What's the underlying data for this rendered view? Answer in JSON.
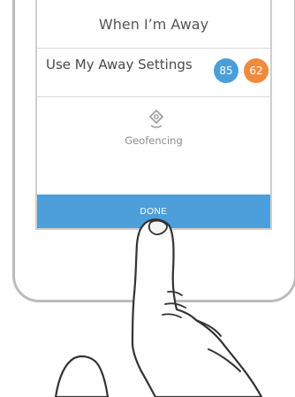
{
  "screen": {
    "header_title": "When I’m Away",
    "away_settings": {
      "label": "Use My Away Settings",
      "cool_setpoint": "85",
      "heat_setpoint": "62"
    },
    "geofencing": {
      "icon": "geofencing-pin-icon",
      "label": "Geofencing"
    },
    "done_label": "DONE"
  },
  "colors": {
    "cool_badge": "#4a9fdb",
    "heat_badge": "#f18a3c",
    "done_button": "#4d9fdb",
    "device_frame": "#bcbcbc"
  }
}
